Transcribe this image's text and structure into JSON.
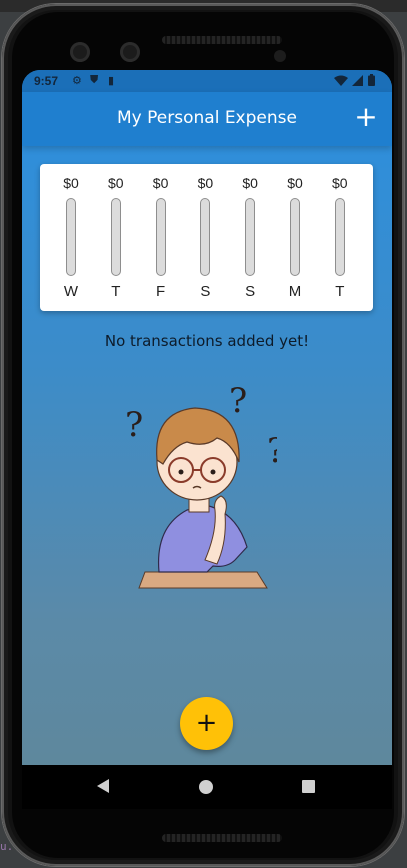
{
  "ide": {
    "fragment": "u."
  },
  "status_bar": {
    "time": "9:57",
    "icons": [
      "settings-icon",
      "shield-icon",
      "sd-card-icon",
      "wifi-icon",
      "signal-icon",
      "battery-icon"
    ]
  },
  "app_bar": {
    "title": "My Personal Expense",
    "add_icon": "+"
  },
  "chart_data": {
    "type": "bar",
    "categories": [
      "W",
      "T",
      "F",
      "S",
      "S",
      "M",
      "T"
    ],
    "values": [
      0,
      0,
      0,
      0,
      0,
      0,
      0
    ],
    "value_labels": [
      "$0",
      "$0",
      "$0",
      "$0",
      "$0",
      "$0",
      "$0"
    ]
  },
  "empty_state": {
    "message": "No transactions added yet!"
  },
  "fab": {
    "icon": "+"
  },
  "colors": {
    "primary": "#1f7fcf",
    "accent": "#ffc107",
    "bar_track": "#dcdcdc"
  }
}
